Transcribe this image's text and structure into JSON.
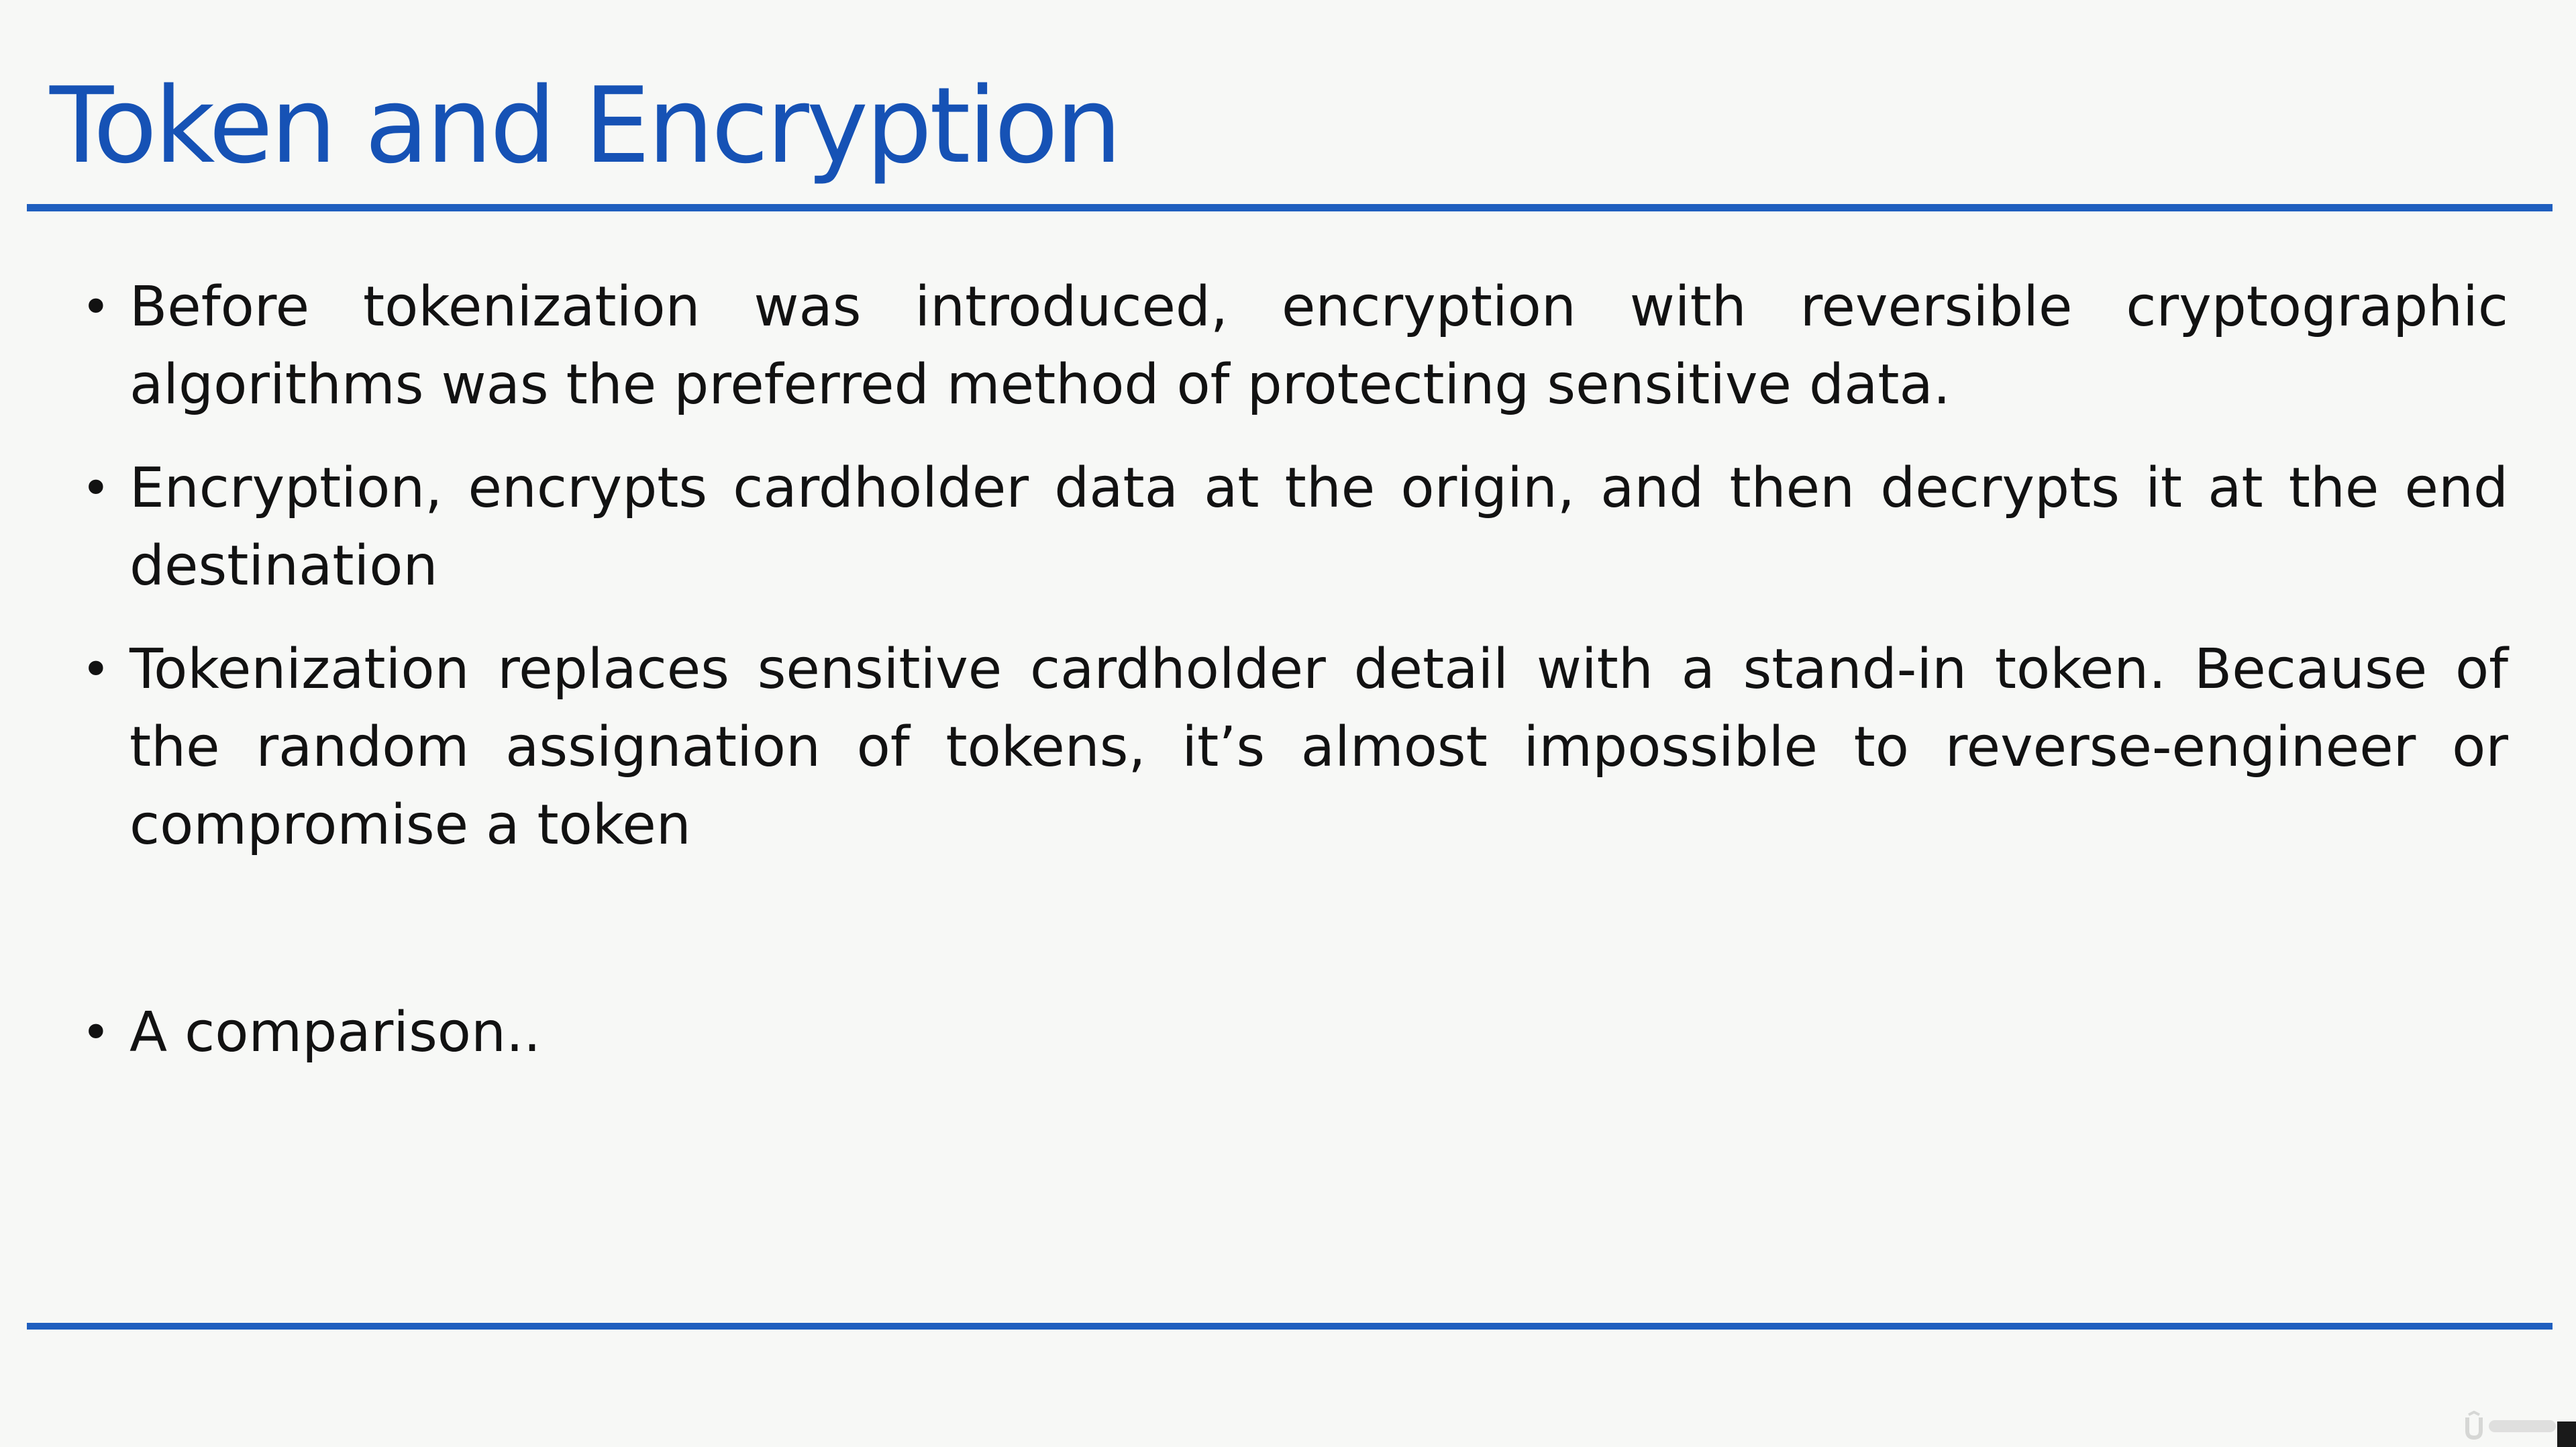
{
  "slide": {
    "title": "Token and Encryption",
    "bullets": [
      "Before tokenization was introduced, encryption with reversible cryptographic algorithms was the preferred method of protecting sensitive data.",
      "Encryption, encrypts cardholder data at the origin, and then decrypts it at the end destination",
      "Tokenization replaces sensitive cardholder detail with a stand-in token. Because of the random assignation of tokens, it’s almost impossible to reverse-engineer or compromise a token",
      "A comparison.."
    ],
    "bullet_symbol": "•",
    "colors": {
      "title": "#1652b5",
      "rule": "#1f5fbf",
      "background": "#f7f8f6",
      "text": "#121212"
    },
    "watermark_icon": "udemy-logo-icon"
  }
}
